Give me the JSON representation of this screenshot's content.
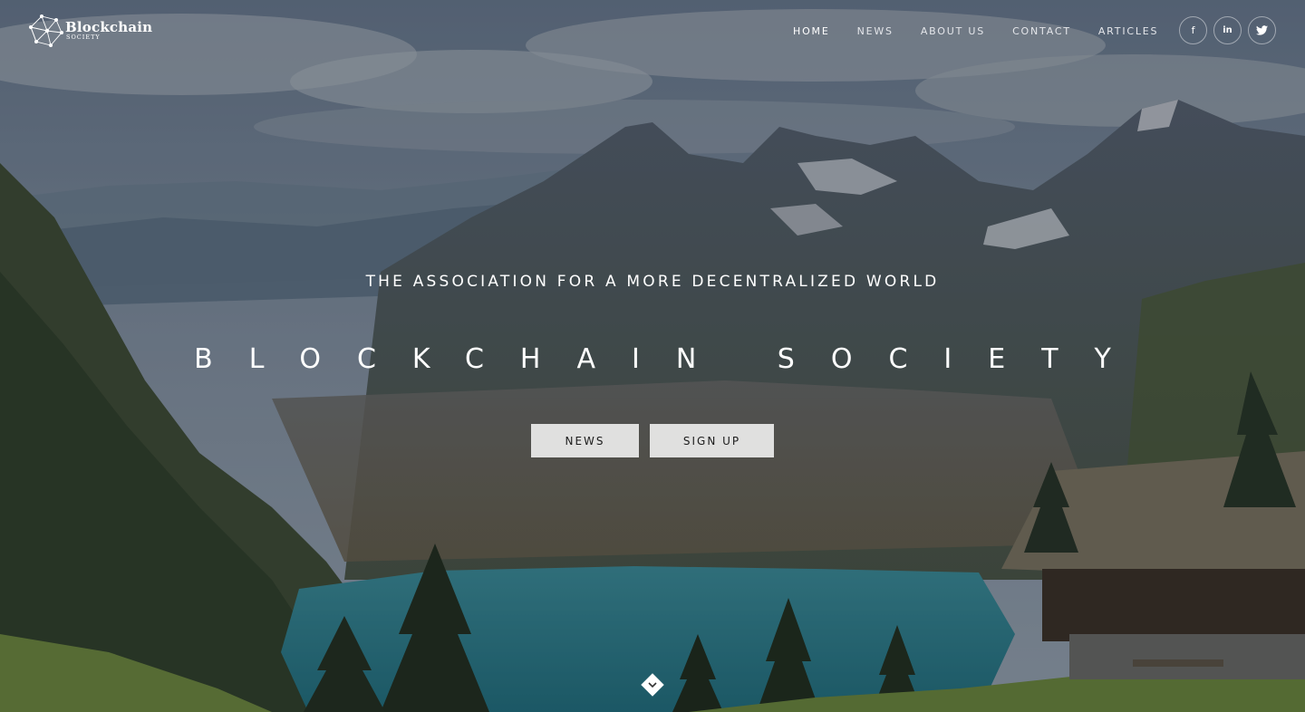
{
  "brand": {
    "name": "Blockchain",
    "sub": "SOCIETY"
  },
  "nav": {
    "items": [
      {
        "label": "HOME",
        "active": true
      },
      {
        "label": "NEWS",
        "active": false
      },
      {
        "label": "ABOUT US",
        "active": false
      },
      {
        "label": "CONTACT",
        "active": false
      },
      {
        "label": "ARTICLES",
        "active": false
      }
    ]
  },
  "social": [
    {
      "icon": "facebook-icon",
      "glyph": "f"
    },
    {
      "icon": "linkedin-icon",
      "glyph": "in"
    },
    {
      "icon": "twitter-icon",
      "glyph": "t"
    }
  ],
  "hero": {
    "tagline": "THE ASSOCIATION FOR A MORE DECENTRALIZED WORLD",
    "title": "BLOCKCHAIN SOCIETY",
    "buttons": {
      "news": "NEWS",
      "signup": "SIGN UP"
    }
  },
  "colors": {
    "text": "#ffffff",
    "button_bg": "#f0f0f0",
    "lake": "#2f93a0"
  }
}
